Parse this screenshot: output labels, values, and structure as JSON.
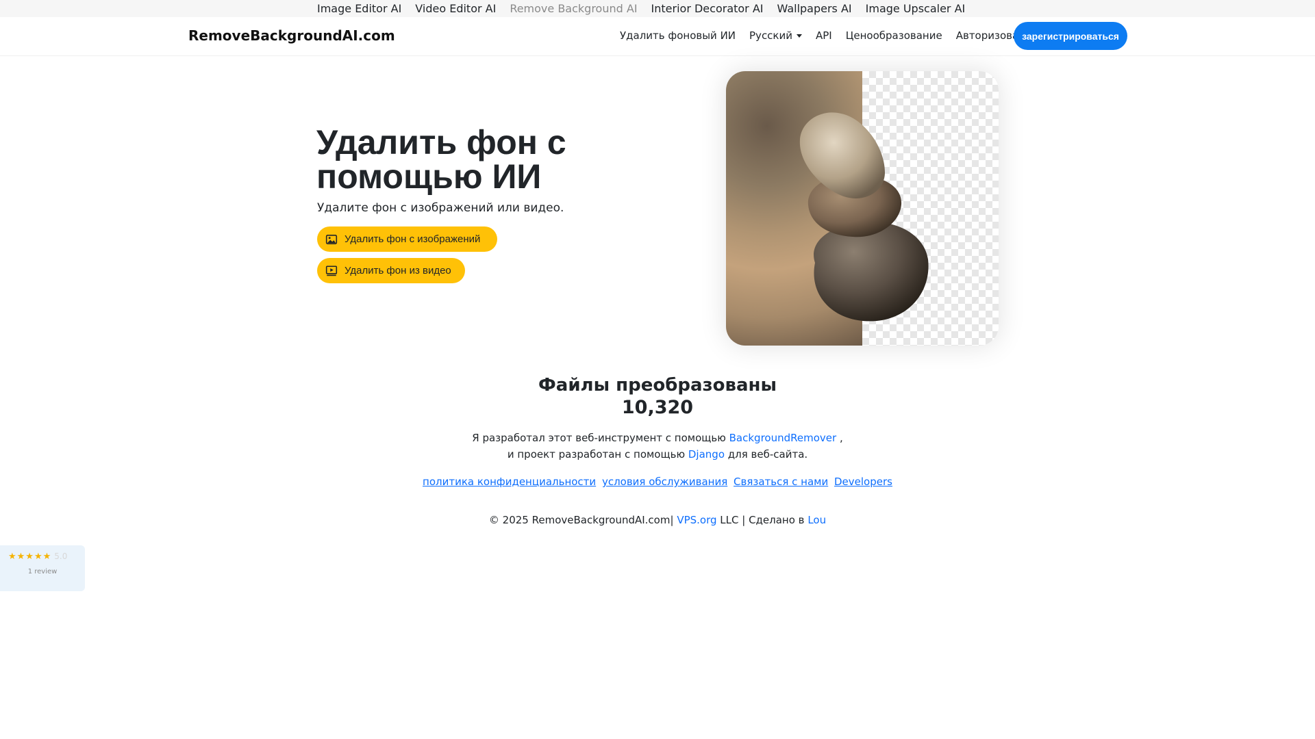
{
  "top_links": [
    "Image Editor AI",
    "Video Editor AI",
    "Remove Background AI",
    "Interior Decorator AI",
    "Wallpapers AI",
    "Image Upscaler AI"
  ],
  "navbar": {
    "brand": "RemoveBackgroundAI.com",
    "remove_bg": "Удалить фоновый ИИ",
    "language": "Русский",
    "api": "API",
    "pricing": "Ценообразование",
    "login": "Авторизоваться",
    "signup": "зарегистрироваться"
  },
  "hero": {
    "title": "Удалить фон с помощью ИИ",
    "subtitle": "Удалите фон с изображений или видео.",
    "btn_image": "Удалить фон с изображений",
    "btn_video": "Удалить фон из видео"
  },
  "stats": {
    "title": "Файлы преобразованы",
    "count": "10,320"
  },
  "credits": {
    "line1_prefix": "Я разработал этот веб-инструмент с помощью",
    "line1_link": "BackgroundRemover",
    "line1_suffix": ",",
    "line2_prefix": "и проект разработан с помощью",
    "line2_link": "Django",
    "line2_suffix": "для веб-сайта."
  },
  "footer_links": {
    "privacy": "политика конфиденциальности",
    "terms": "условия обслуживания",
    "contact": "Связаться с нами",
    "developers": "Developers"
  },
  "copyright": {
    "prefix": "© 2025 RemoveBackgroundAI.com|",
    "vps": "VPS.org",
    "mid": "LLC | Сделано в",
    "lou": "Lou"
  },
  "review_widget": {
    "stars": "★★★★★",
    "score": "5.0",
    "count": "1 review"
  },
  "colors": {
    "signup_bg": "#0d7cf2",
    "cta_bg": "#ffc107",
    "link": "#0d6efd"
  }
}
